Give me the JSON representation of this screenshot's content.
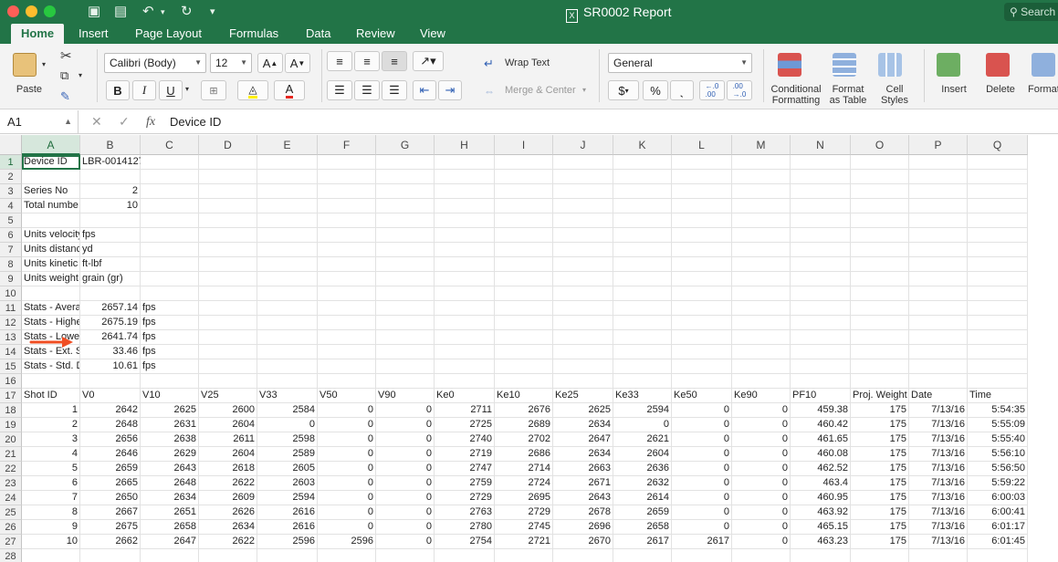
{
  "window": {
    "title": "SR0002 Report",
    "search_placeholder": "Search"
  },
  "tabs": [
    "Home",
    "Insert",
    "Page Layout",
    "Formulas",
    "Data",
    "Review",
    "View"
  ],
  "ribbon": {
    "paste": "Paste",
    "font_name": "Calibri (Body)",
    "font_size": "12",
    "bold": "B",
    "italic": "I",
    "underline": "U",
    "wrap_text": "Wrap Text",
    "merge_center": "Merge & Center",
    "number_format": "General",
    "currency": "$",
    "percent": "%",
    "comma": "ˎ",
    "conditional_formatting": [
      "Conditional",
      "Formatting"
    ],
    "format_as_table": [
      "Format",
      "as Table"
    ],
    "cell_styles": [
      "Cell",
      "Styles"
    ],
    "insert": "Insert",
    "delete": "Delete",
    "format": "Format"
  },
  "formula_bar": {
    "name_box": "A1",
    "fx": "fx",
    "content": "Device ID"
  },
  "columns": [
    "A",
    "B",
    "C",
    "D",
    "E",
    "F",
    "G",
    "H",
    "I",
    "J",
    "K",
    "L",
    "M",
    "N",
    "O",
    "P",
    "Q"
  ],
  "rows": [
    {
      "n": "1",
      "cells": {
        "A": "Device ID",
        "B": "LBR-0014127"
      }
    },
    {
      "n": "2",
      "cells": {}
    },
    {
      "n": "3",
      "cells": {
        "A": "Series No",
        "B": "2"
      }
    },
    {
      "n": "4",
      "cells": {
        "A": "Total numbe",
        "B": "10"
      }
    },
    {
      "n": "5",
      "cells": {}
    },
    {
      "n": "6",
      "cells": {
        "A": "Units velocity",
        "B": "fps"
      }
    },
    {
      "n": "7",
      "cells": {
        "A": "Units distanc",
        "B": "yd"
      }
    },
    {
      "n": "8",
      "cells": {
        "A": "Units kinetic",
        "B": "ft-lbf"
      }
    },
    {
      "n": "9",
      "cells": {
        "A": "Units weight",
        "B": "grain (gr)"
      }
    },
    {
      "n": "10",
      "cells": {}
    },
    {
      "n": "11",
      "cells": {
        "A": "Stats - Avera",
        "B": "2657.14",
        "C": "fps"
      }
    },
    {
      "n": "12",
      "cells": {
        "A": "Stats - Highe",
        "B": "2675.19",
        "C": "fps"
      }
    },
    {
      "n": "13",
      "cells": {
        "A": "Stats - Lowes",
        "B": "2641.74",
        "C": "fps"
      }
    },
    {
      "n": "14",
      "cells": {
        "A": "Stats - Ext. Sp",
        "B": "33.46",
        "C": "fps"
      }
    },
    {
      "n": "15",
      "cells": {
        "A": "Stats - Std. D",
        "B": "10.61",
        "C": "fps"
      }
    },
    {
      "n": "16",
      "cells": {}
    },
    {
      "n": "17",
      "cells": {
        "A": "Shot ID",
        "B": "V0",
        "C": "V10",
        "D": "V25",
        "E": "V33",
        "F": "V50",
        "G": "V90",
        "H": "Ke0",
        "I": "Ke10",
        "J": "Ke25",
        "K": "Ke33",
        "L": "Ke50",
        "M": "Ke90",
        "N": "PF10",
        "O": "Proj. Weight",
        "P": "Date",
        "Q": "Time"
      }
    },
    {
      "n": "18",
      "cells": {
        "A": "1",
        "B": "2642",
        "C": "2625",
        "D": "2600",
        "E": "2584",
        "F": "0",
        "G": "0",
        "H": "2711",
        "I": "2676",
        "J": "2625",
        "K": "2594",
        "L": "0",
        "M": "0",
        "N": "459.38",
        "O": "175",
        "P": "7/13/16",
        "Q": "5:54:35"
      }
    },
    {
      "n": "19",
      "cells": {
        "A": "2",
        "B": "2648",
        "C": "2631",
        "D": "2604",
        "E": "0",
        "F": "0",
        "G": "0",
        "H": "2725",
        "I": "2689",
        "J": "2634",
        "K": "0",
        "L": "0",
        "M": "0",
        "N": "460.42",
        "O": "175",
        "P": "7/13/16",
        "Q": "5:55:09"
      }
    },
    {
      "n": "20",
      "cells": {
        "A": "3",
        "B": "2656",
        "C": "2638",
        "D": "2611",
        "E": "2598",
        "F": "0",
        "G": "0",
        "H": "2740",
        "I": "2702",
        "J": "2647",
        "K": "2621",
        "L": "0",
        "M": "0",
        "N": "461.65",
        "O": "175",
        "P": "7/13/16",
        "Q": "5:55:40"
      }
    },
    {
      "n": "21",
      "cells": {
        "A": "4",
        "B": "2646",
        "C": "2629",
        "D": "2604",
        "E": "2589",
        "F": "0",
        "G": "0",
        "H": "2719",
        "I": "2686",
        "J": "2634",
        "K": "2604",
        "L": "0",
        "M": "0",
        "N": "460.08",
        "O": "175",
        "P": "7/13/16",
        "Q": "5:56:10"
      }
    },
    {
      "n": "22",
      "cells": {
        "A": "5",
        "B": "2659",
        "C": "2643",
        "D": "2618",
        "E": "2605",
        "F": "0",
        "G": "0",
        "H": "2747",
        "I": "2714",
        "J": "2663",
        "K": "2636",
        "L": "0",
        "M": "0",
        "N": "462.52",
        "O": "175",
        "P": "7/13/16",
        "Q": "5:56:50"
      }
    },
    {
      "n": "23",
      "cells": {
        "A": "6",
        "B": "2665",
        "C": "2648",
        "D": "2622",
        "E": "2603",
        "F": "0",
        "G": "0",
        "H": "2759",
        "I": "2724",
        "J": "2671",
        "K": "2632",
        "L": "0",
        "M": "0",
        "N": "463.4",
        "O": "175",
        "P": "7/13/16",
        "Q": "5:59:22"
      }
    },
    {
      "n": "24",
      "cells": {
        "A": "7",
        "B": "2650",
        "C": "2634",
        "D": "2609",
        "E": "2594",
        "F": "0",
        "G": "0",
        "H": "2729",
        "I": "2695",
        "J": "2643",
        "K": "2614",
        "L": "0",
        "M": "0",
        "N": "460.95",
        "O": "175",
        "P": "7/13/16",
        "Q": "6:00:03"
      }
    },
    {
      "n": "25",
      "cells": {
        "A": "8",
        "B": "2667",
        "C": "2651",
        "D": "2626",
        "E": "2616",
        "F": "0",
        "G": "0",
        "H": "2763",
        "I": "2729",
        "J": "2678",
        "K": "2659",
        "L": "0",
        "M": "0",
        "N": "463.92",
        "O": "175",
        "P": "7/13/16",
        "Q": "6:00:41"
      }
    },
    {
      "n": "26",
      "cells": {
        "A": "9",
        "B": "2675",
        "C": "2658",
        "D": "2634",
        "E": "2616",
        "F": "0",
        "G": "0",
        "H": "2780",
        "I": "2745",
        "J": "2696",
        "K": "2658",
        "L": "0",
        "M": "0",
        "N": "465.15",
        "O": "175",
        "P": "7/13/16",
        "Q": "6:01:17"
      }
    },
    {
      "n": "27",
      "cells": {
        "A": "10",
        "B": "2662",
        "C": "2647",
        "D": "2622",
        "E": "2596",
        "F": "2596",
        "G": "0",
        "H": "2754",
        "I": "2721",
        "J": "2670",
        "K": "2617",
        "L": "2617",
        "M": "0",
        "N": "463.23",
        "O": "175",
        "P": "7/13/16",
        "Q": "6:01:45"
      }
    },
    {
      "n": "28",
      "cells": {}
    }
  ],
  "colors": {
    "excel_green": "#227447",
    "arrow": "#f04e23"
  }
}
